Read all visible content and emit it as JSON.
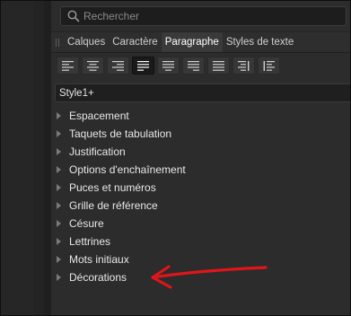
{
  "search": {
    "placeholder": "Rechercher",
    "value": ""
  },
  "tabs": [
    {
      "label": "Calques",
      "active": false
    },
    {
      "label": "Caractère",
      "active": false
    },
    {
      "label": "Paragraphe",
      "active": true
    },
    {
      "label": "Styles de texte",
      "active": false
    }
  ],
  "toolbar": {
    "buttons": [
      {
        "icon": "align-left-icon"
      },
      {
        "icon": "align-center-icon"
      },
      {
        "icon": "align-right-icon"
      },
      {
        "icon": "justify-all-icon",
        "active": true
      },
      {
        "icon": "justify-center-icon"
      },
      {
        "icon": "justify-right-icon"
      },
      {
        "icon": "justify-full-icon"
      },
      {
        "icon": "align-towards-spine-icon"
      },
      {
        "icon": "align-away-spine-icon"
      }
    ]
  },
  "paragraph_style": {
    "value": "Style1+"
  },
  "sections": [
    {
      "label": "Espacement"
    },
    {
      "label": "Taquets de tabulation"
    },
    {
      "label": "Justification"
    },
    {
      "label": "Options d'enchaînement"
    },
    {
      "label": "Puces et numéros"
    },
    {
      "label": "Grille de référence"
    },
    {
      "label": "Césure"
    },
    {
      "label": "Lettrines"
    },
    {
      "label": "Mots initiaux"
    },
    {
      "label": "Décorations"
    }
  ],
  "colors": {
    "panel_bg": "#2c2c2c",
    "text": "#e8e8e8",
    "annotation_arrow": "#e0151b"
  }
}
